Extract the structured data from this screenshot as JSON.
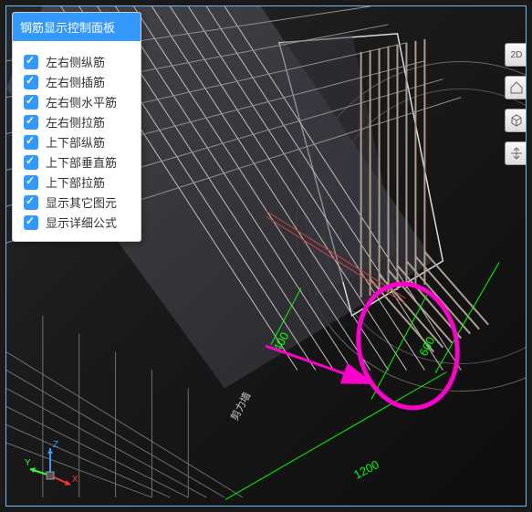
{
  "panel": {
    "title": "钢筋显示控制面板",
    "items": [
      {
        "label": "左右侧纵筋",
        "checked": true
      },
      {
        "label": "左右侧插筋",
        "checked": true
      },
      {
        "label": "左右侧水平筋",
        "checked": true
      },
      {
        "label": "左右侧拉筋",
        "checked": true
      },
      {
        "label": "上下部纵筋",
        "checked": true
      },
      {
        "label": "上下部垂直筋",
        "checked": true
      },
      {
        "label": "上下部拉筋",
        "checked": true
      },
      {
        "label": "显示其它图元",
        "checked": true
      },
      {
        "label": "显示详细公式",
        "checked": true
      }
    ]
  },
  "dimensions": {
    "d400": "400",
    "d600": "600",
    "d1200": "1200"
  },
  "sidebar": {
    "btn1": "2D",
    "btn2": "home",
    "btn3": "cube",
    "btn4": "pan"
  },
  "axis": {
    "x": "X",
    "y": "Y",
    "z": "Z"
  },
  "annotation": {
    "src_edge": "剪力墙"
  }
}
